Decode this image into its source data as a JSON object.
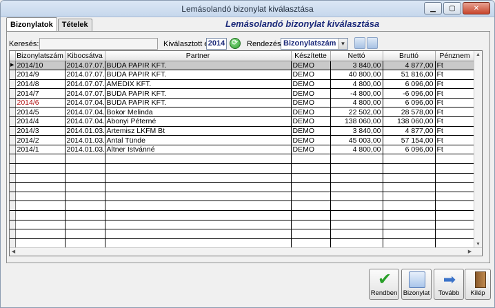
{
  "window": {
    "title": "Lemásolandó bizonylat kiválasztása",
    "minimize": "▁",
    "restore": "▢",
    "close": "✕"
  },
  "tabs": [
    "Bizonylatok",
    "Tételek"
  ],
  "form_title": "Lemásolandó bizonylat kiválasztása",
  "filter": {
    "search_label": "Keresés:",
    "search_value": "",
    "year_label": "Kiválasztott év.",
    "year_value": "2014",
    "sort_label": "Rendezés:",
    "sort_value": "Bizonylatszám"
  },
  "grid": {
    "columns": [
      "Bizonylatszám",
      "Kibocsátva",
      "Partner",
      "Készítette",
      "Nettó",
      "Bruttó",
      "Pénznem"
    ],
    "rows": [
      [
        "2014/10",
        "2014.07.07.",
        "BUDA PAPIR KFT.",
        "DEMO",
        "3 840,00",
        "4 877,00",
        "Ft"
      ],
      [
        "2014/9",
        "2014.07.07.",
        "BUDA PAPIR KFT.",
        "DEMO",
        "40 800,00",
        "51 816,00",
        "Ft"
      ],
      [
        "2014/8",
        "2014.07.07.",
        "AMEDIX KFT.",
        "DEMO",
        "4 800,00",
        "6 096,00",
        "Ft"
      ],
      [
        "2014/7",
        "2014.07.07.",
        "BUDA PAPIR KFT.",
        "DEMO",
        "-4 800,00",
        "-6 096,00",
        "Ft"
      ],
      [
        "2014/6",
        "2014.07.04.",
        "BUDA PAPIR KFT.",
        "DEMO",
        "4 800,00",
        "6 096,00",
        "Ft"
      ],
      [
        "2014/5",
        "2014.07.04.",
        "Bokor Melinda",
        "DEMO",
        "22 502,00",
        "28 578,00",
        "Ft"
      ],
      [
        "2014/4",
        "2014.07.04.",
        "Abonyi Péterné",
        "DEMO",
        "138 060,00",
        "138 060,00",
        "Ft"
      ],
      [
        "2014/3",
        "2014.01.03.",
        "Artemisz LKFM Bt",
        "DEMO",
        "3 840,00",
        "4 877,00",
        "Ft"
      ],
      [
        "2014/2",
        "2014.01.03.",
        "Antal Tünde",
        "DEMO",
        "45 003,00",
        "57 154,00",
        "Ft"
      ],
      [
        "2014/1",
        "2014.01.03.",
        "Altner Istvánné",
        "DEMO",
        "4 800,00",
        "6 096,00",
        "Ft"
      ]
    ],
    "selected_row": 0,
    "highlight_row": 4
  },
  "buttons": {
    "ok": "Rendben",
    "document": "Bizonylat",
    "next": "Tovább",
    "exit": "Kilép"
  },
  "icons": {
    "ok": "check-icon",
    "document": "document-preview-icon",
    "next": "arrow-right-icon",
    "exit": "door-exit-icon"
  }
}
